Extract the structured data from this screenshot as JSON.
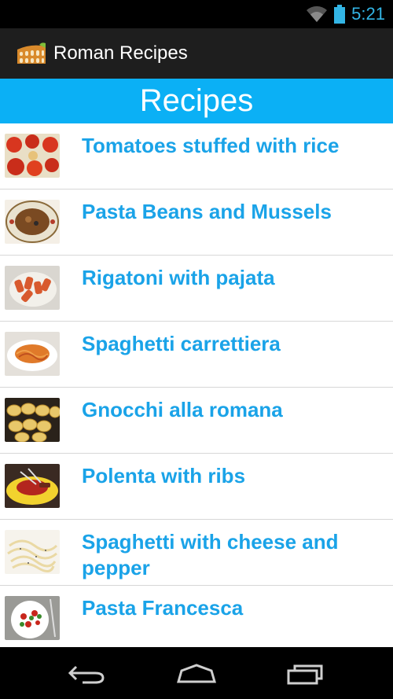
{
  "status": {
    "time": "5:21",
    "wifi_icon": "wifi-icon",
    "battery_icon": "battery-icon"
  },
  "app": {
    "title": "Roman Recipes",
    "icon": "colosseum-icon"
  },
  "header": {
    "title": "Recipes",
    "color": "#0bb0f5"
  },
  "recipes": [
    {
      "title": "Tomatoes stuffed with rice",
      "thumb": "tomatoes-thumbnail"
    },
    {
      "title": "Pasta Beans and Mussels",
      "thumb": "soup-thumbnail"
    },
    {
      "title": "Rigatoni with pajata",
      "thumb": "rigatoni-thumbnail"
    },
    {
      "title": "Spaghetti carrettiera",
      "thumb": "spaghetti-thumbnail"
    },
    {
      "title": "Gnocchi alla romana",
      "thumb": "gnocchi-thumbnail"
    },
    {
      "title": "Polenta with ribs",
      "thumb": "polenta-thumbnail"
    },
    {
      "title": "Spaghetti with cheese and pepper",
      "thumb": "cacio-pepe-thumbnail"
    },
    {
      "title": "Pasta Francesca",
      "thumb": "pasta-francesca-thumbnail"
    }
  ],
  "nav": {
    "back_icon": "back-icon",
    "home_icon": "home-icon",
    "recents_icon": "recent-apps-icon"
  },
  "colors": {
    "accent": "#1aa3e8",
    "action_bar": "#1e1e1e"
  }
}
